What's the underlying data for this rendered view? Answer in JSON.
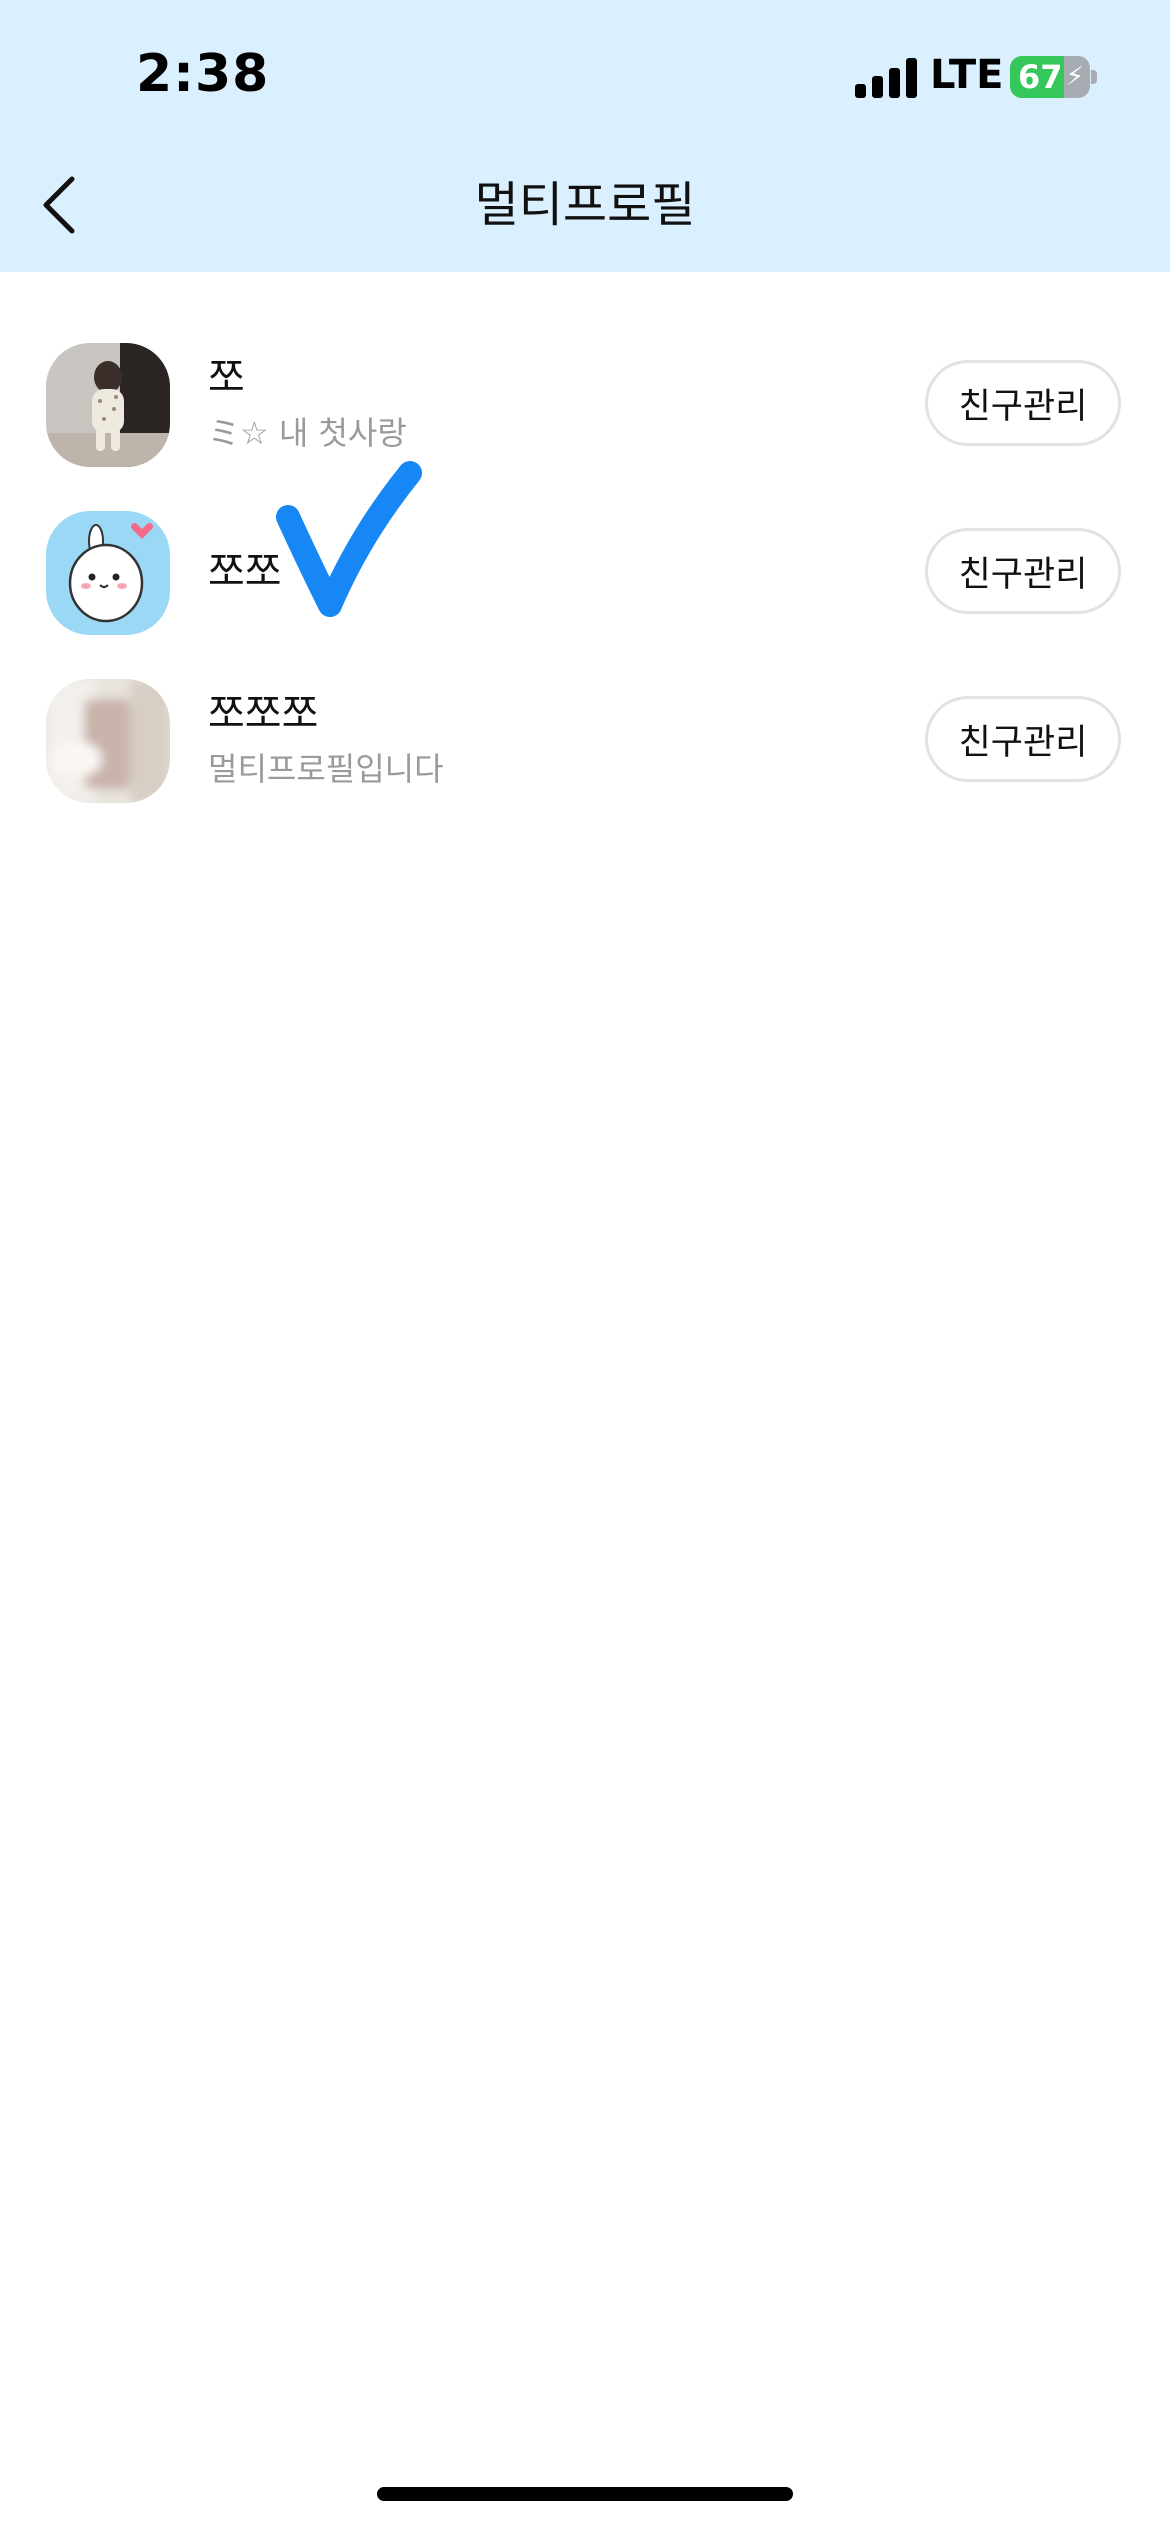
{
  "status_bar": {
    "time": "2:38",
    "network": "LTE",
    "battery": "67",
    "battery_level": 0.67
  },
  "header": {
    "back_icon": "chevron-left-icon",
    "title": "멀티프로필"
  },
  "profiles": [
    {
      "name": "쪼",
      "status": "ミ☆ 내 첫사랑",
      "button": "친구관리"
    },
    {
      "name": "쪼쪼",
      "status": "",
      "button": "친구관리"
    },
    {
      "name": "쪼쪼쪼",
      "status": "멀티프로필입니다",
      "button": "친구관리"
    }
  ],
  "colors": {
    "header_bg": "#dbf0fe",
    "check_mark": "#1787f5",
    "battery_green": "#34c759"
  }
}
